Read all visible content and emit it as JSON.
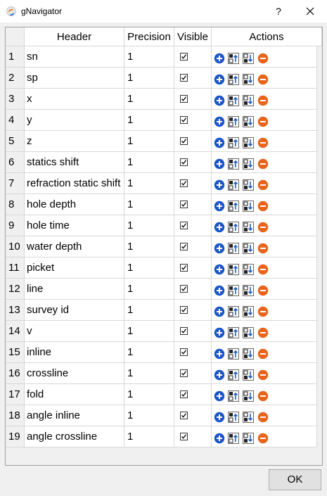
{
  "window": {
    "title": "gNavigator",
    "help_label": "?"
  },
  "table": {
    "columns": [
      "Header",
      "Precision",
      "Visible",
      "Actions"
    ],
    "rows": [
      {
        "num": "1",
        "header": "sn",
        "precision": "1",
        "visible": true
      },
      {
        "num": "2",
        "header": "sp",
        "precision": "1",
        "visible": true
      },
      {
        "num": "3",
        "header": "x",
        "precision": "1",
        "visible": true
      },
      {
        "num": "4",
        "header": "y",
        "precision": "1",
        "visible": true
      },
      {
        "num": "5",
        "header": "z",
        "precision": "1",
        "visible": true
      },
      {
        "num": "6",
        "header": "statics shift",
        "precision": "1",
        "visible": true
      },
      {
        "num": "7",
        "header": "refraction static shift",
        "precision": "1",
        "visible": true
      },
      {
        "num": "8",
        "header": "hole depth",
        "precision": "1",
        "visible": true
      },
      {
        "num": "9",
        "header": "hole time",
        "precision": "1",
        "visible": true
      },
      {
        "num": "10",
        "header": "water depth",
        "precision": "1",
        "visible": true
      },
      {
        "num": "11",
        "header": "picket",
        "precision": "1",
        "visible": true
      },
      {
        "num": "12",
        "header": "line",
        "precision": "1",
        "visible": true
      },
      {
        "num": "13",
        "header": "survey id",
        "precision": "1",
        "visible": true
      },
      {
        "num": "14",
        "header": "v",
        "precision": "1",
        "visible": true
      },
      {
        "num": "15",
        "header": "inline",
        "precision": "1",
        "visible": true
      },
      {
        "num": "16",
        "header": "crossline",
        "precision": "1",
        "visible": true
      },
      {
        "num": "17",
        "header": "fold",
        "precision": "1",
        "visible": true
      },
      {
        "num": "18",
        "header": "angle inline",
        "precision": "1",
        "visible": true
      },
      {
        "num": "19",
        "header": "angle crossline",
        "precision": "1",
        "visible": true
      }
    ],
    "action_icons": [
      "add-icon",
      "move-up-icon",
      "move-down-icon",
      "remove-icon"
    ]
  },
  "footer": {
    "ok_label": "OK"
  },
  "colors": {
    "add": "#1a56c4",
    "remove": "#e8641b",
    "accent": "#1f5fbf"
  }
}
